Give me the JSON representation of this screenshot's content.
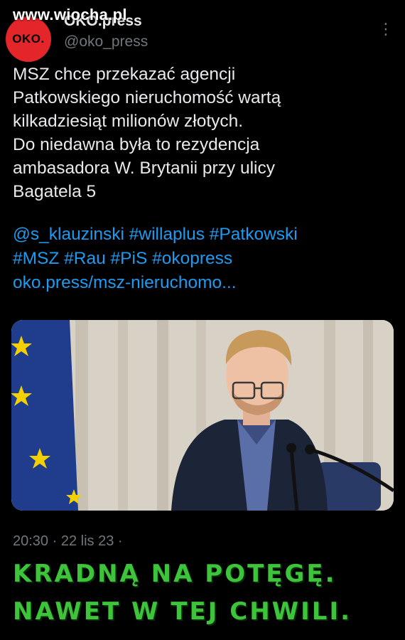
{
  "watermark": "www.wiocha.pl",
  "account": {
    "avatar_text": "OKO.",
    "display_name": "OKO.press",
    "handle": "@oko_press"
  },
  "tweet": {
    "text": "MSZ chce przekazać agencji\nPatkowskiego nieruchomość wartą\nkilkadziesiąt milionów złotych.\nDo niedawna była to rezydencja\nambasadora W. Brytanii przy ulicy\nBagatela 5",
    "tags": [
      "@s_klauzinski",
      "#willaplus",
      "#Patkowski",
      "#MSZ",
      "#Rau",
      "#PiS",
      "#okopress"
    ],
    "link": "oko.press/msz-nieruchomo...",
    "timestamp": "20:30 · 22 lis 23 ·"
  },
  "overlay_caption": {
    "line1": "KRADNĄ NA POTĘGĘ.",
    "line2": "NAWET W TEJ CHWILI."
  },
  "colors": {
    "background": "#000000",
    "link": "#1d9bf0",
    "caption": "#3dc43a",
    "avatar": "#e4262a"
  }
}
